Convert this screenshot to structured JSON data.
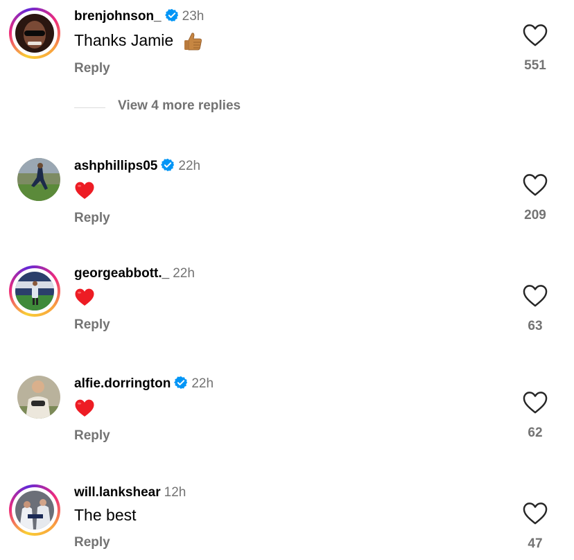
{
  "comments": [
    {
      "username": "brenjohnson_",
      "verified": true,
      "time": "23h",
      "text": "Thanks Jamie",
      "emoji": "thumbs-up",
      "reply": "Reply",
      "likes": "551",
      "story_ring": true
    },
    {
      "username": "ashphillips05",
      "verified": true,
      "time": "22h",
      "text": "",
      "emoji": "red-heart",
      "reply": "Reply",
      "likes": "209",
      "story_ring": false
    },
    {
      "username": "georgeabbott._",
      "verified": false,
      "time": "22h",
      "text": "",
      "emoji": "red-heart",
      "reply": "Reply",
      "likes": "63",
      "story_ring": true
    },
    {
      "username": "alfie.dorrington",
      "verified": true,
      "time": "22h",
      "text": "",
      "emoji": "red-heart",
      "reply": "Reply",
      "likes": "62",
      "story_ring": false
    },
    {
      "username": "will.lankshear",
      "verified": false,
      "time": "12h",
      "text": "The best",
      "emoji": "",
      "reply": "Reply",
      "likes": "47",
      "story_ring": true
    }
  ],
  "view_more_replies": "View 4 more replies",
  "colors": {
    "verified": "#0095f6",
    "secondary_text": "#737373",
    "heart": "#ed1c24"
  }
}
